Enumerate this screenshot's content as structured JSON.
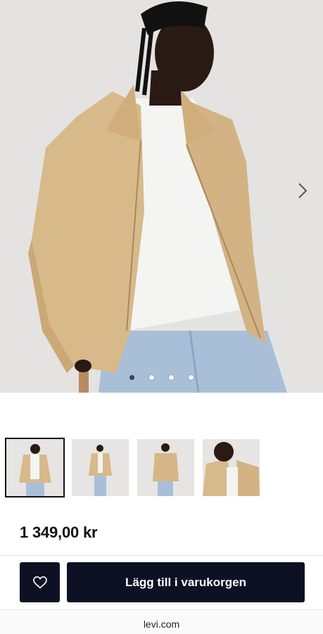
{
  "gallery": {
    "image_alt": "Model wearing beige zip jacket, white t-shirt and light blue jeans",
    "dots_total": 4,
    "dot_active_index": 0
  },
  "thumbnails": [
    {
      "label": "Front view"
    },
    {
      "label": "Full body front"
    },
    {
      "label": "Back view"
    },
    {
      "label": "Close-up"
    }
  ],
  "product": {
    "price": "1 349,00 kr"
  },
  "actions": {
    "add_to_cart_label": "Lägg till i varukorgen"
  },
  "browser": {
    "url": "levi.com"
  },
  "colors": {
    "button_bg": "#0d1124",
    "jacket": "#d8b98a",
    "background": "#e4e3e1"
  },
  "icons": {
    "favorite": "heart-icon",
    "next": "chevron-right-icon"
  }
}
